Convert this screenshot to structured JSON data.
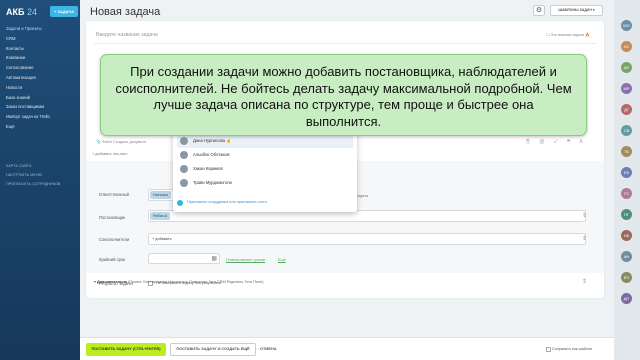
{
  "sidebar": {
    "logo_main": "АКБ",
    "logo_num": "24",
    "create_label": "+ ЗАДАЧА",
    "items": [
      {
        "label": "Задачи и Проекты"
      },
      {
        "label": "CRM"
      },
      {
        "label": "Контакты"
      },
      {
        "label": "Компании"
      },
      {
        "label": "Согласование"
      },
      {
        "label": "Автоматизация"
      },
      {
        "label": "Новости"
      },
      {
        "label": "База знаний"
      },
      {
        "label": "Заказ поставщикам"
      },
      {
        "label": "Импорт задач из Trello"
      },
      {
        "label": "Ещё"
      }
    ],
    "sub_items": [
      {
        "label": "КАРТА САЙТА"
      },
      {
        "label": "НАСТРОИТЬ МЕНЮ"
      },
      {
        "label": "ПРИГЛАСИТЬ СОТРУДНИКОВ"
      }
    ]
  },
  "header": {
    "title": "Новая задача",
    "templates_label": "ШАБЛОНЫ ЗАДАЧ ▾"
  },
  "task": {
    "name_placeholder": "Введите название задачи",
    "important_label": "Это важная задача",
    "add_list": "+ добавить чек-лист",
    "editor_tools": "Файл   Создать документ"
  },
  "banner": {
    "text": "При создании задачи можно добавить постановщика, наблюдателей и соисполнителей. Не бойтесь делать задачу максимальной подробной. Чем лучше задача описана по структуре, тем проще и быстрее она выполнится."
  },
  "form": {
    "responsible_label": "Ответственный",
    "responsible_chip": "Наталья",
    "author_label": "Постановщик",
    "author_chip": "Рабиз А",
    "add_label": "+ добавить",
    "coexec_label": "Соисполнители",
    "deadline_label": "Крайний срок",
    "plan_link": "Планирование сроков",
    "more_link": "Ещё",
    "result_label": "Результат задачи",
    "result_check": "Не завершать задачу без результата",
    "project_hint": "задача",
    "extra_label": "Дополнительно",
    "extra_items": "(Проект  Учёт времени  Напомнить  Повторить  Ганг  CRM  Родитель  Теги  Поля)"
  },
  "popup": {
    "people": [
      {
        "name": "Дана Нурписова"
      },
      {
        "name": "Альибек Оботжков"
      },
      {
        "name": "Хакан Каримов"
      },
      {
        "name": "Трави Мурджанголи"
      }
    ],
    "invite_label": "Пригласить сотрудника",
    "invite_or": "или",
    "invite_guest": "пригласить гостя"
  },
  "footer": {
    "primary_label": "ПОСТАВИТЬ ЗАДАЧУ (CTRL+ENTER)",
    "secondary_label": "ПОСТАВИТЬ ЗАДАЧУ И СОЗДАТЬ ЕЩЁ",
    "cancel_label": "ОТМЕНА",
    "save_template_label": "Сохранить как шаблон"
  },
  "rail": {
    "avatars": [
      "МО",
      "НС",
      "АР",
      "МР",
      "ДГ",
      "СВ",
      "ТБ",
      "ЕК",
      "ГС",
      "ПГ",
      "НБ",
      "АН",
      "ЕП",
      "ДП"
    ]
  }
}
